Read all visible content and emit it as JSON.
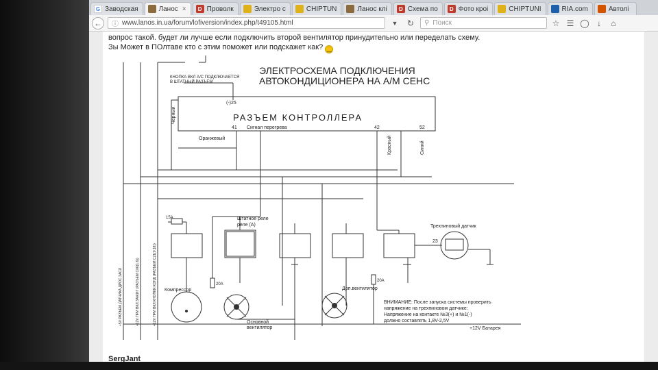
{
  "browser": {
    "tabs": [
      {
        "favicon": "g",
        "title": "Заводская"
      },
      {
        "favicon": "l",
        "title": "Ланос",
        "active": true
      },
      {
        "favicon": "d",
        "title": "Проволк"
      },
      {
        "favicon": "c",
        "title": "Электро с"
      },
      {
        "favicon": "c",
        "title": "CHIPTUN"
      },
      {
        "favicon": "l",
        "title": "Ланос клі"
      },
      {
        "favicon": "d",
        "title": "Схема по"
      },
      {
        "favicon": "d",
        "title": "Фото кроі"
      },
      {
        "favicon": "c",
        "title": "CHIPTUNI"
      },
      {
        "favicon": "r",
        "title": "RIA.com"
      },
      {
        "favicon": "a",
        "title": "Автолі"
      }
    ],
    "url": "www.lanos.in.ua/forum/lofiversion/index.php/t49105.html",
    "search_placeholder": "Поиск"
  },
  "post": {
    "line1": "вопрос такой. будет ли лучше если подключить второй вентилятор принудительно или переделать схему.",
    "line2": "Зы Может в ПОлтаве кто с этим поможет или подскажет как?",
    "author": "SergJant"
  },
  "diagram": {
    "title_line1": "ЭЛЕКТРОСХЕМА ПОДКЛЮЧЕНИЯ",
    "title_line2": "АВТОКОНДИЦИОНЕРА НА А/М СЕНС",
    "button_label_line1": "КНОПКА ВКЛ А/С ПОДКЛЮЧАЕТСЯ",
    "button_label_line2": "В ШТАТНЫЙ РАЗЪЕМ",
    "controller": "РАЗЪЕМ КОНТРОЛЛЕРА",
    "pin25": "(-)25",
    "pin41": "41",
    "pin42": "42",
    "pin52": "52",
    "overheat_signal": "Сигнал перегрева",
    "wire_black": "Черный",
    "wire_orange": "Оранжевый",
    "wire_red": "Красный",
    "wire_blue": "Синий",
    "fuse15": "15А",
    "fuse20a": "20А",
    "fuse20b": "20А",
    "stock_relay_line1": "Штатное реле",
    "stock_relay_line2": "реле (А)",
    "sensor": "Трехпиновый датчик",
    "sensor_pin": "23",
    "compressor": "Компрессор",
    "main_fan_line1": "Основной",
    "main_fan_line2": "вентилятор",
    "extra_fan": "Доп.вентилятор",
    "warning_line1": "ВНИМАНИЕ: После запуска системы проверить",
    "warning_line2": "напряжение на трехпиновом датчике:",
    "warning_line3": "Напряжение на контакте №3(+) и №1(-)",
    "warning_line4": "должно составлять 1,8V-2,5V",
    "battery": "+12V Батарея",
    "vert1": "+5V РАЗЪЕМ ДАТЧИКА ДРОС.ЗАСЛ",
    "vert2": "+12V ПРИ ВКЛ ЗАЖИГ (РАЗЪЕМ С06(1.6))",
    "vert3": "+12V ПРИ ВКЛ КНОПКИ КОНД (РАЗЪЕМ С21(0.18))"
  },
  "colors": {
    "tabbar": "#cfd3d8",
    "page": "#ffffff",
    "wire": "#333333"
  }
}
